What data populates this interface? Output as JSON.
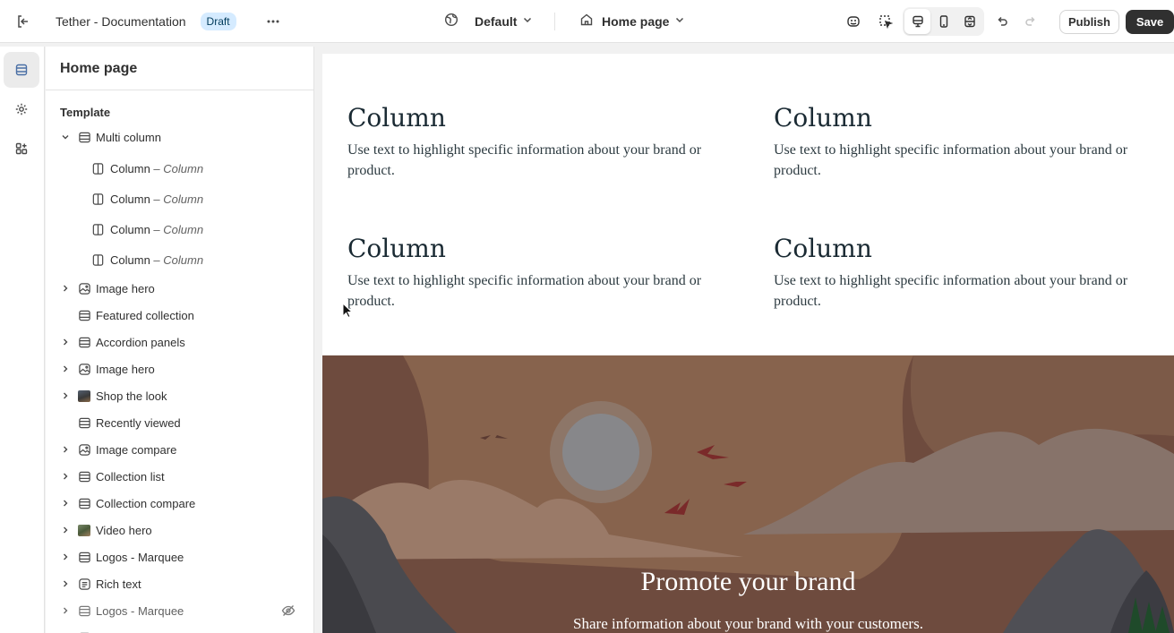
{
  "topbar": {
    "store_name": "Tether - Documentation",
    "status_badge": "Draft",
    "theme_select": "Default",
    "page_select": "Home page",
    "publish_label": "Publish",
    "save_label": "Save"
  },
  "sidebar": {
    "title": "Home page",
    "section_label": "Template",
    "items": [
      {
        "label": "Multi column",
        "icon": "section-icon",
        "expanded": true
      },
      {
        "label": "Column",
        "sub": "– Column",
        "icon": "column-block-icon"
      },
      {
        "label": "Column",
        "sub": "– Column",
        "icon": "column-block-icon"
      },
      {
        "label": "Column",
        "sub": "– Column",
        "icon": "column-block-icon"
      },
      {
        "label": "Column",
        "sub": "– Column",
        "icon": "column-block-icon"
      },
      {
        "label": "Image hero",
        "icon": "image-icon"
      },
      {
        "label": "Featured collection",
        "icon": "section-icon"
      },
      {
        "label": "Accordion panels",
        "icon": "section-icon"
      },
      {
        "label": "Image hero",
        "icon": "image-icon"
      },
      {
        "label": "Shop the look",
        "icon": "thumbnail-icon"
      },
      {
        "label": "Recently viewed",
        "icon": "section-icon"
      },
      {
        "label": "Image compare",
        "icon": "image-icon"
      },
      {
        "label": "Collection list",
        "icon": "section-icon"
      },
      {
        "label": "Collection compare",
        "icon": "section-icon"
      },
      {
        "label": "Video hero",
        "icon": "thumbnail-icon"
      },
      {
        "label": "Logos - Marquee",
        "icon": "section-icon"
      },
      {
        "label": "Rich text",
        "icon": "text-icon"
      },
      {
        "label": "Logos - Marquee",
        "icon": "section-icon",
        "hidden": true
      }
    ]
  },
  "preview": {
    "columns": [
      {
        "heading": "Column",
        "text": "Use text to highlight specific information about your brand or product."
      },
      {
        "heading": "Column",
        "text": "Use text to highlight specific information about your brand or product."
      },
      {
        "heading": "Column",
        "text": "Use text to highlight specific information about your brand or product."
      },
      {
        "heading": "Column",
        "text": "Use text to highlight specific information about your brand or product."
      }
    ],
    "hero_title": "Promote your brand",
    "hero_text": "Share information about your brand with your customers."
  }
}
